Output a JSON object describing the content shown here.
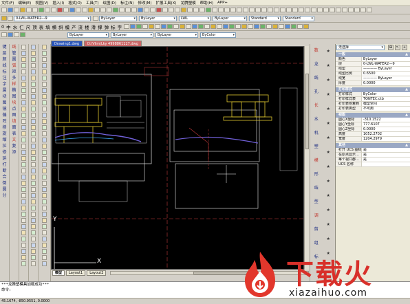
{
  "menu": [
    "文件(F)",
    "编辑(E)",
    "视图(V)",
    "插入(I)",
    "格式(O)",
    "工具(T)",
    "绘图(D)",
    "标注(N)",
    "修改(M)",
    "扩展工具(X)",
    "龙腾塑模",
    "帮助(H)",
    "APP+"
  ],
  "toolbar2": {
    "layer_value": "0-LWL-WATER2---9",
    "linetype_value": "ByLayer",
    "color_value": "ByLayer",
    "lineweight_value": "ByLayer",
    "plotstyle_value": "ByColor",
    "layer2_value": "LWL",
    "style1": "Standard",
    "style2": "Standard",
    "dim_value": "ByLayer"
  },
  "toolbar3": {
    "chars": [
      "0",
      "中",
      "水",
      "仁",
      "尺",
      "顶",
      "表",
      "填",
      "横",
      "斜",
      "模",
      "产",
      "流",
      "楼",
      "滑",
      "撑",
      "弹",
      "标",
      "字"
    ]
  },
  "toolbar4": {
    "color_value": "ByLayer",
    "linetype_value": "ByLayer",
    "lineweight_value": "ByLayer",
    "plot_value": "ByColor"
  },
  "left_chars": {
    "a": [
      "键",
      "层",
      "颜",
      "线",
      "标",
      "注",
      "字",
      "属",
      "块",
      "图",
      "镜",
      "偏",
      "阵",
      "移",
      "旋",
      "缩",
      "拉",
      "修",
      "延",
      "打",
      "断",
      "合",
      "倒",
      "圆",
      "分"
    ],
    "b": [
      "线",
      "管",
      "圆",
      "弧",
      "矩",
      "多",
      "样",
      "椭",
      "图",
      "块",
      "点",
      "图",
      "填",
      "面",
      "表",
      "文",
      "复",
      "添"
    ]
  },
  "doctabs": {
    "active": "Drawing1.dwg",
    "second": "D:\\Vlim\\Lky 4998861127.dwg"
  },
  "canvas": {
    "axis_x": "X",
    "axis_y": "Y"
  },
  "layouts": [
    "模型",
    "Layout1",
    "Layout2"
  ],
  "right_chars": {
    "a": [
      "数",
      "龙",
      "线",
      "孔",
      "长",
      "水",
      "机",
      "塑",
      "模",
      "形",
      "结",
      "型",
      "调",
      "剪",
      "组",
      "标"
    ],
    "b": [
      "★",
      "★",
      "★",
      "★",
      "★",
      "★",
      "★",
      "★",
      "★",
      "★",
      "★",
      "★",
      "★",
      "★",
      "★"
    ]
  },
  "props": {
    "select_value": "无选择",
    "sections": [
      {
        "title": "一般",
        "rows": [
          [
            "颜色",
            "ByLayer"
          ],
          [
            "层",
            "0-LWL-WATER2---9"
          ],
          [
            "线型",
            "———— ByLayer"
          ],
          [
            "线型比例",
            "0.6500"
          ],
          [
            "线宽",
            "———— ByLayer"
          ],
          [
            "厚度",
            "0.0000"
          ]
        ]
      },
      {
        "title": "打印样式",
        "rows": [
          [
            "打印样式",
            "ByColor"
          ],
          [
            "打印样式表",
            "TONTEC.ctb"
          ],
          [
            "打印表附着到",
            "模型空间"
          ],
          [
            "打印表类型",
            "不可用"
          ]
        ]
      },
      {
        "title": "视图",
        "rows": [
          [
            "圆心X坐标",
            "-310.1522"
          ],
          [
            "圆心Y坐标",
            "777.6107"
          ],
          [
            "圆心Z坐标",
            "0.0000"
          ],
          [
            "高度",
            "1052.2702"
          ],
          [
            "宽度",
            "1204.2979"
          ]
        ]
      },
      {
        "title": "其他",
        "rows": [
          [
            "打开 UCS 图标",
            "是"
          ],
          [
            "在原点显示…",
            "是"
          ],
          [
            "每个视口都…",
            "是"
          ],
          [
            "UCS 名称",
            ""
          ]
        ]
      }
    ]
  },
  "command": {
    "line1": "***龙腾塑模具加载成功***",
    "line2": "命令:"
  },
  "status": {
    "coords": "45.1674, -850.9551, 0.0000"
  },
  "watermark": {
    "title": "下载火",
    "sub": "xiazaihuo.com"
  },
  "colors": {
    "canvas_bg": "#000000",
    "accent": "#d8302a"
  }
}
